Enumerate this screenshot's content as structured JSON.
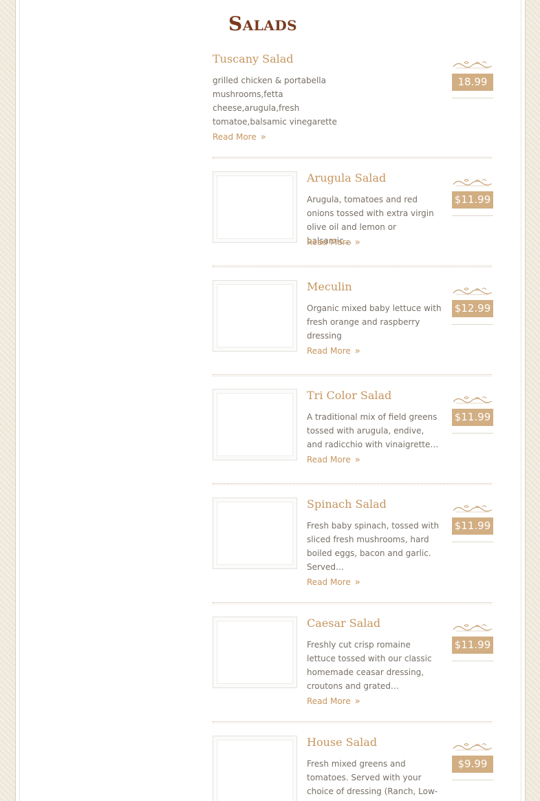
{
  "section": {
    "title": "Salads"
  },
  "read_more_label": "Read More",
  "colors": {
    "accent": "#c6955e",
    "price_bg": "#d2ae83",
    "title": "#7a3b1e",
    "text": "#776f66"
  },
  "items": [
    {
      "name": "Tuscany Salad",
      "description": "grilled chicken & portabella mushrooms,fetta cheese,arugula,fresh tomatoe,balsamic vinegarette",
      "price": "18.99",
      "has_thumbnail": false
    },
    {
      "name": "Arugula Salad",
      "description": "Arugula, tomatoes and red onions tossed with extra virgin olive oil and lemon or balsamic…",
      "price": "$11.99",
      "has_thumbnail": true
    },
    {
      "name": "Meculin",
      "description": "Organic mixed baby lettuce with fresh orange and raspberry dressing",
      "price": "$12.99",
      "has_thumbnail": true
    },
    {
      "name": "Tri Color Salad",
      "description": "A traditional mix of field greens tossed with arugula, endive, and radicchio with vinaigrette…",
      "price": "$11.99",
      "has_thumbnail": true
    },
    {
      "name": "Spinach Salad",
      "description": "Fresh baby spinach, tossed with sliced fresh mushrooms, hard boiled eggs, bacon and garlic. Served…",
      "price": "$11.99",
      "has_thumbnail": true
    },
    {
      "name": "Caesar Salad",
      "description": "Freshly cut crisp romaine lettuce tossed with our classic homemade ceasar dressing, croutons and grated…",
      "price": "$11.99",
      "has_thumbnail": true
    },
    {
      "name": "House Salad",
      "description": "Fresh mixed greens and tomatoes. Served with your choice of dressing (Ranch, Low-",
      "price": "$9.99",
      "has_thumbnail": true
    }
  ]
}
